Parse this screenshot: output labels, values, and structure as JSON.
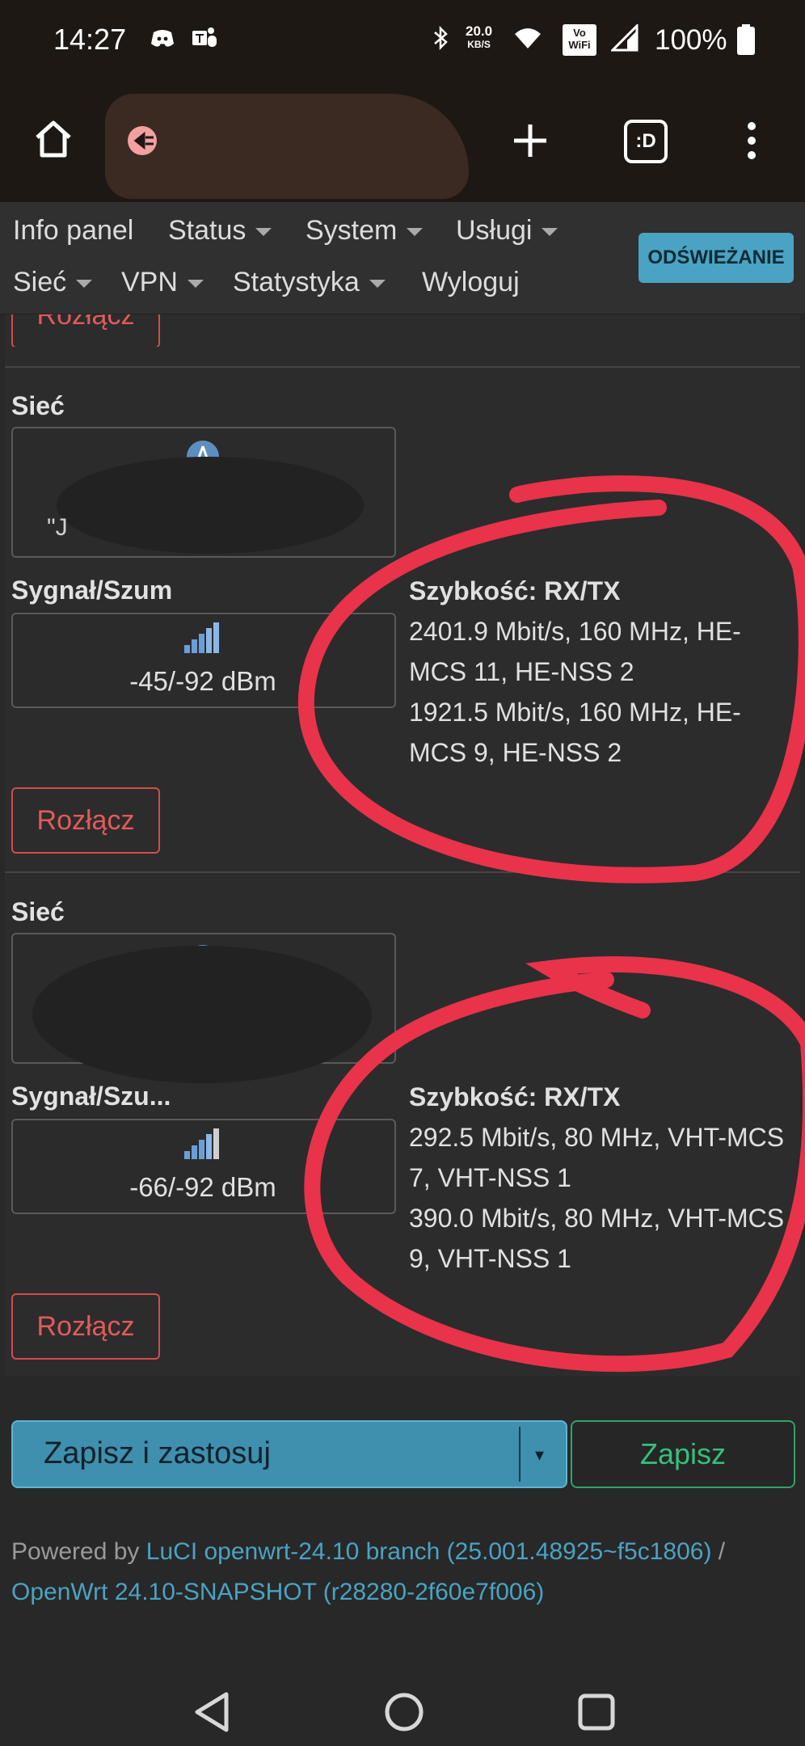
{
  "status_bar": {
    "time": "14:27",
    "net_speed_value": "20.0",
    "net_speed_unit": "KB/S",
    "battery": "100%",
    "vowifi_top": "Vo",
    "vowifi_bottom": "WiFi"
  },
  "browser": {
    "tab_label": ":D"
  },
  "nav": {
    "items": [
      "Info panel",
      "Status",
      "System",
      "Usługi",
      "Sieć",
      "VPN",
      "Statystyka",
      "Wyloguj"
    ],
    "refresh": "ODŚWIEŻANIE"
  },
  "top_button": "Rozłącz",
  "stations": [
    {
      "network_label": "Sieć",
      "network_value": "\"J",
      "signal_label": "Sygnał/Szum",
      "signal_value": "-45/-92 dBm",
      "rate_label": "Szybkość: RX/TX",
      "rx": "2401.9 Mbit/s, 160 MHz, HE-MCS 11, HE-NSS 2",
      "tx": "1921.5 Mbit/s, 160 MHz, HE-MCS 9, HE-NSS 2",
      "disconnect": "Rozłącz"
    },
    {
      "network_label": "Sieć",
      "network_value": "",
      "signal_label": "Sygnał/Szu...",
      "signal_value": "-66/-92 dBm",
      "rate_label": "Szybkość: RX/TX",
      "rx": "292.5 Mbit/s, 80 MHz, VHT-MCS 7, VHT-NSS 1",
      "tx": "390.0 Mbit/s, 80 MHz, VHT-MCS 9, VHT-NSS 1",
      "disconnect": "Rozłącz"
    }
  ],
  "actions": {
    "save_apply": "Zapisz i zastosuj",
    "save": "Zapisz"
  },
  "footer": {
    "powered_by": "Powered by",
    "luci_link": "LuCI openwrt-24.10 branch (25.001.48925~f5c1806)",
    "separator": "/",
    "openwrt_link": "OpenWrt 24.10-SNAPSHOT (r28280-2f60e7f006)"
  },
  "colors": {
    "annotation": "#e8334a",
    "accent": "#4aa3c3",
    "danger": "#d44c4c",
    "success": "#2fa36b"
  }
}
